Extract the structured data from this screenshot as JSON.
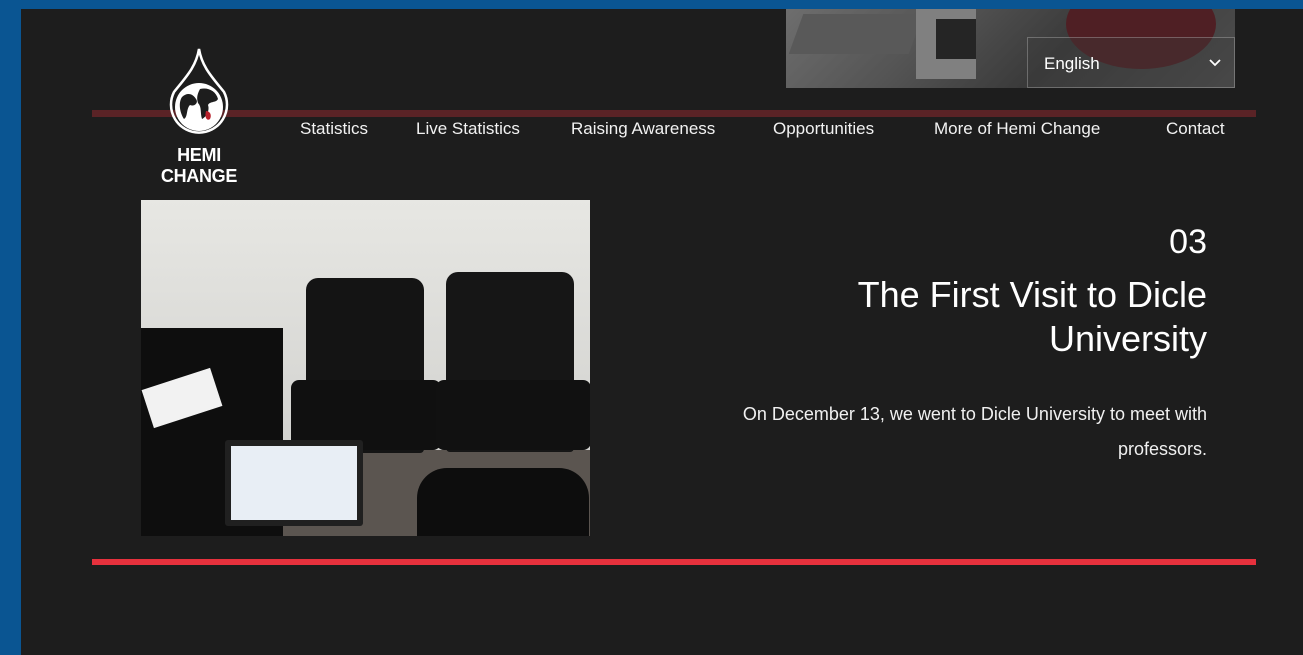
{
  "brand": {
    "name": "HEMI CHANGE",
    "logo_icon": "globe-drop-icon"
  },
  "language": {
    "selected": "English",
    "icon": "chevron-down-icon"
  },
  "nav": {
    "items": [
      {
        "label": "Statistics"
      },
      {
        "label": "Live Statistics"
      },
      {
        "label": "Raising Awareness"
      },
      {
        "label": "Opportunities"
      },
      {
        "label": "More of Hemi Change"
      },
      {
        "label": "Contact"
      }
    ]
  },
  "post": {
    "number": "03",
    "title": "The First Visit to Dicle University",
    "description": "On December 13, we went to Dicle University to meet with professors."
  },
  "colors": {
    "accent": "#e6313d",
    "frame": "#0a5592",
    "background": "#1d1d1d"
  }
}
